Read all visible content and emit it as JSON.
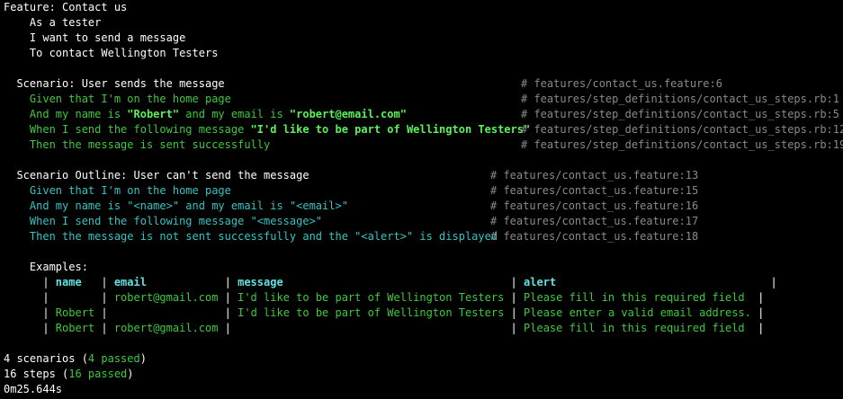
{
  "feature": {
    "title": "Feature: Contact us",
    "narrative": [
      "As a tester",
      "I want to send a message",
      "To contact Wellington Testers"
    ]
  },
  "scenario1": {
    "title": "Scenario: User sends the message",
    "location": "# features/contact_us.feature:6",
    "steps": [
      {
        "parts": [
          "Given that I'm on the home page"
        ],
        "location": "# features/step_definitions/contact_us_steps.rb:1"
      },
      {
        "parts": [
          "And my name is ",
          "\"Robert\"",
          " and my email is ",
          "\"robert@email.com\""
        ],
        "location": "# features/step_definitions/contact_us_steps.rb:5"
      },
      {
        "parts": [
          "When I send the following message ",
          "\"I'd like to be part of Wellington Testers\""
        ],
        "location": "# features/step_definitions/contact_us_steps.rb:12"
      },
      {
        "parts": [
          "Then the message is sent successfully"
        ],
        "location": "# features/step_definitions/contact_us_steps.rb:19"
      }
    ]
  },
  "scenario2": {
    "title": "Scenario Outline: User can't send the message",
    "location": "# features/contact_us.feature:13",
    "steps": [
      {
        "text": "Given that I'm on the home page",
        "location": "# features/contact_us.feature:15"
      },
      {
        "text": "And my name is \"<name>\" and my email is \"<email>\"",
        "location": "# features/contact_us.feature:16"
      },
      {
        "text": "When I send the following message \"<message>\"",
        "location": "# features/contact_us.feature:17"
      },
      {
        "text": "Then the message is not sent successfully and the \"<alert>\" is displayed",
        "location": "# features/contact_us.feature:18"
      }
    ],
    "examples_label": "Examples:",
    "table_header": [
      "name",
      "email",
      "message",
      "alert"
    ],
    "table_rows": [
      [
        "",
        "robert@gmail.com",
        "I'd like to be part of Wellington Testers",
        "Please fill in this required field"
      ],
      [
        "Robert",
        "",
        "I'd like to be part of Wellington Testers",
        "Please enter a valid email address."
      ],
      [
        "Robert",
        "robert@gmail.com",
        "",
        "Please fill in this required field"
      ]
    ]
  },
  "summary": {
    "scenarios_prefix": "4 scenarios (",
    "scenarios_passed": "4 passed",
    "scenarios_suffix": ")",
    "steps_prefix": "16 steps (",
    "steps_passed": "16 passed",
    "steps_suffix": ")",
    "duration": "0m25.644s"
  },
  "colors": {
    "background": "#000000",
    "text": "#ffffff",
    "passed": "#3ec93e",
    "outline": "#36c3c3",
    "comment": "#8a8a8a"
  }
}
